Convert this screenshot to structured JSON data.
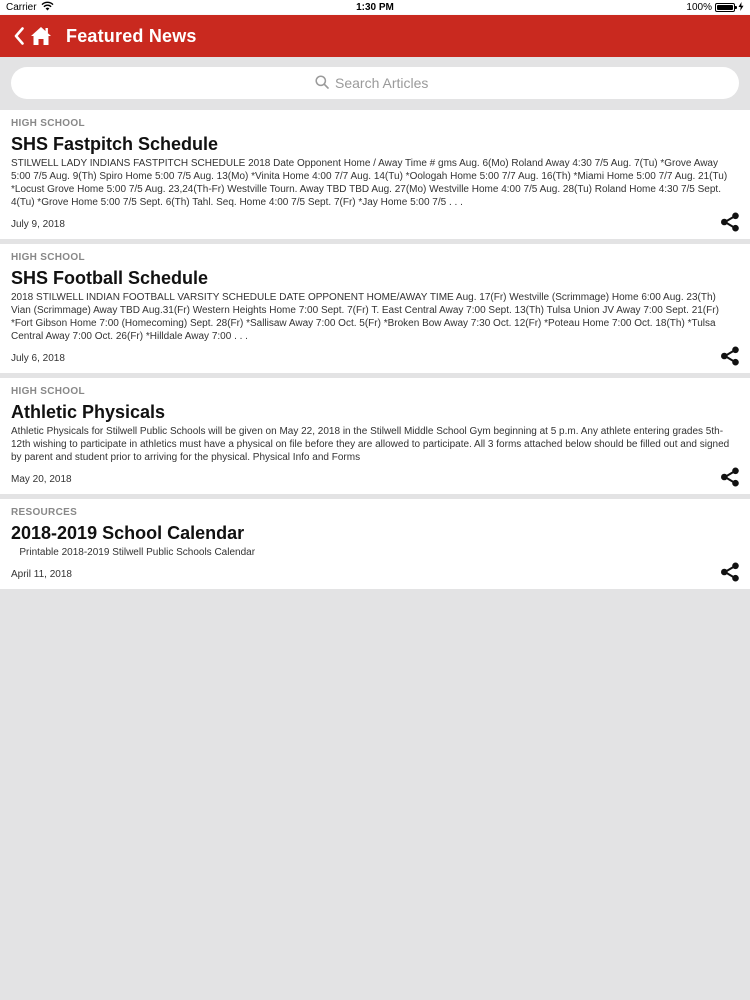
{
  "status_bar": {
    "carrier": "Carrier",
    "time": "1:30 PM",
    "battery": "100%",
    "battery_level": 1.0
  },
  "nav": {
    "title": "Featured News",
    "back_icon": "chevron-left-icon",
    "home_icon": "home-icon"
  },
  "search": {
    "placeholder": "Search Articles",
    "icon": "search-icon"
  },
  "colors": {
    "nav_bg": "#c9291f",
    "page_bg": "#e3e3e4",
    "category_text": "#888888"
  },
  "articles": [
    {
      "category": "HIGH SCHOOL",
      "title": "SHS Fastpitch Schedule",
      "excerpt": "STILWELL LADY INDIANS FASTPITCH SCHEDULE 2018   Date Opponent Home / Away Time # gms   Aug. 6(Mo) Roland Away 4:30 7/5 Aug. 7(Tu) *Grove Away 5:00 7/5 Aug. 9(Th) Spiro Home 5:00 7/5 Aug. 13(Mo) *Vinita Home 4:00 7/7 Aug. 14(Tu) *Oologah Home 5:00 7/7 Aug. 16(Th) *Miami Home 5:00 7/7 Aug. 21(Tu) *Locust Grove Home 5:00 7/5 Aug. 23,24(Th-Fr) Westville Tourn. Away TBD TBD Aug. 27(Mo) Westville Home 4:00 7/5 Aug. 28(Tu) Roland Home 4:30 7/5    Sept. 4(Tu) *Grove Home 5:00 7/5 Sept. 6(Th) Tahl. Seq. Home 4:00 7/5 Sept. 7(Fr) *Jay Home 5:00 7/5 . . .",
      "date": "July 9, 2018"
    },
    {
      "category": "HIGH SCHOOL",
      "title": "SHS Football Schedule",
      "excerpt": "2018 STILWELL INDIAN FOOTBALL VARSITY SCHEDULE    DATE OPPONENT HOME/AWAY TIME    Aug. 17(Fr) Westville (Scrimmage) Home 6:00    Aug. 23(Th) Vian (Scrimmage) Away TBD    Aug.31(Fr) Western Heights Home 7:00    Sept. 7(Fr) T. East Central Away 7:00    Sept. 13(Th) Tulsa Union JV Away 7:00    Sept. 21(Fr) *Fort Gibson Home 7:00 (Homecoming)    Sept. 28(Fr) *Sallisaw Away 7:00    Oct. 5(Fr) *Broken Bow Away 7:30    Oct. 12(Fr) *Poteau Home 7:00    Oct. 18(Th) *Tulsa Central Away 7:00    Oct. 26(Fr) *Hilldale Away 7:00    . . .",
      "date": "July 6, 2018"
    },
    {
      "category": "HIGH SCHOOL",
      "title": "Athletic Physicals",
      "excerpt": "Athletic Physicals for Stilwell Public Schools will be given on May 22, 2018 in the Stilwell Middle School Gym beginning at 5 p.m. Any athlete entering grades 5th-12th wishing to participate in athletics must have a physical on file before they are allowed to participate.  All 3 forms attached below should be filled out and signed by parent and student prior to arriving for the physical.   Physical Info and Forms",
      "date": "May 20, 2018"
    },
    {
      "category": "RESOURCES",
      "title": "2018-2019 School Calendar",
      "excerpt": "   Printable 2018-2019 Stilwell Public Schools Calendar",
      "date": "April 11, 2018"
    }
  ]
}
